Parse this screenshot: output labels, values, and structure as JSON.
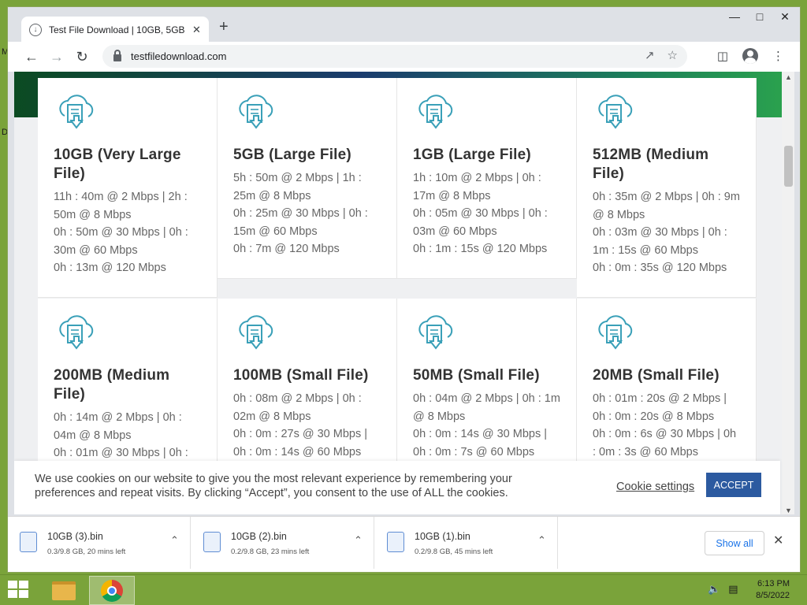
{
  "desktop": {
    "edge_glyph_top": "M",
    "edge_glyph_mid": "D"
  },
  "window": {
    "tab_title": "Test File Download | 10GB, 5GB, …",
    "url": "testfiledownload.com"
  },
  "cards": [
    {
      "title": "10GB (Very Large File)",
      "lines": [
        "11h : 40m @ 2 Mbps | 2h : 50m @ 8 Mbps",
        "0h : 50m @ 30 Mbps | 0h : 30m @ 60 Mbps",
        "0h : 13m @ 120 Mbps"
      ]
    },
    {
      "title": "5GB (Large File)",
      "lines": [
        "5h : 50m @ 2 Mbps | 1h : 25m @ 8 Mbps",
        "0h : 25m @ 30 Mbps | 0h : 15m @ 60 Mbps",
        "0h : 7m @ 120 Mbps"
      ]
    },
    {
      "title": "1GB (Large File)",
      "lines": [
        "1h : 10m @ 2 Mbps | 0h : 17m @ 8 Mbps",
        "0h : 05m @ 30 Mbps | 0h : 03m @ 60 Mbps",
        "0h : 1m : 15s @ 120 Mbps"
      ]
    },
    {
      "title": "512MB (Medium File)",
      "lines": [
        "0h : 35m @ 2 Mbps | 0h : 9m @ 8 Mbps",
        "0h : 03m @ 30 Mbps | 0h : 1m : 15s @ 60 Mbps",
        "0h : 0m : 35s @ 120 Mbps"
      ]
    },
    {
      "title": "200MB (Medium File)",
      "lines": [
        "0h : 14m @ 2 Mbps | 0h : 04m @ 8 Mbps",
        "0h : 01m @ 30 Mbps | 0h :"
      ]
    },
    {
      "title": "100MB (Small File)",
      "lines": [
        "0h : 08m @ 2 Mbps | 0h : 02m @ 8 Mbps",
        "0h : 0m : 27s @ 30 Mbps | 0h : 0m : 14s @ 60 Mbps"
      ]
    },
    {
      "title": "50MB (Small File)",
      "lines": [
        "0h : 04m @ 2 Mbps | 0h : 1m @ 8 Mbps",
        "0h : 0m : 14s @ 30 Mbps | 0h : 0m : 7s @ 60 Mbps"
      ]
    },
    {
      "title": "20MB (Small File)",
      "lines": [
        "0h : 01m : 20s @ 2 Mbps | 0h : 0m : 20s @ 8 Mbps",
        "0h : 0m : 6s @ 30 Mbps | 0h : 0m : 3s @ 60 Mbps"
      ]
    }
  ],
  "cookie": {
    "text": "We use cookies on our website to give you the most relevant experience by remembering your preferences and repeat visits. By clicking “Accept”, you consent to the use of ALL the cookies.",
    "settings_label": "Cookie settings",
    "accept_label": "ACCEPT"
  },
  "downloads": {
    "items": [
      {
        "name": "10GB (3).bin",
        "status": "0.3/9.8 GB, 20 mins left"
      },
      {
        "name": "10GB (2).bin",
        "status": "0.2/9.8 GB, 23 mins left"
      },
      {
        "name": "10GB (1).bin",
        "status": "0.2/9.8 GB, 45 mins left"
      }
    ],
    "show_all_label": "Show all"
  },
  "taskbar": {
    "time": "6:13 PM",
    "date": "8/5/2022"
  },
  "colors": {
    "accent": "#2c5aa0",
    "icon_teal": "#3aa0b8",
    "desktop": "#7aa33a"
  }
}
